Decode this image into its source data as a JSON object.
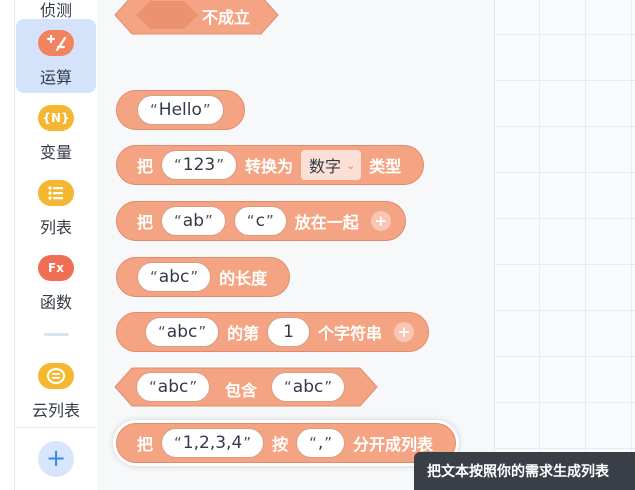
{
  "sidebar": {
    "items": [
      {
        "label": "侦测",
        "icon": "sensing-icon",
        "color": "#4fbf9f"
      },
      {
        "label": "运算",
        "icon": "operators-icon",
        "color": "#f1845f",
        "active": true,
        "glyph": "+−"
      },
      {
        "label": "变量",
        "icon": "variable-icon",
        "color": "#f4b731",
        "glyph": "{N}"
      },
      {
        "label": "列表",
        "icon": "list-icon",
        "color": "#f4b731",
        "glyph": "≡"
      },
      {
        "label": "函数",
        "icon": "function-icon",
        "color": "#ef6f55",
        "glyph": "Fx"
      },
      {
        "label": "云列表",
        "icon": "cloud-list-icon",
        "color": "#f4b731",
        "glyph": "☰"
      }
    ],
    "add_button": "+"
  },
  "blocks": {
    "not_true": {
      "label": "不成立"
    },
    "text_literal": {
      "value": "Hello"
    },
    "convert": {
      "prefix": "把",
      "value": "123",
      "middle": "转换为",
      "type_value": "数字",
      "suffix": "类型"
    },
    "join": {
      "prefix": "把",
      "value1": "ab",
      "value2": "c",
      "suffix": "放在一起",
      "add": "+"
    },
    "length": {
      "value": "abc",
      "suffix": "的长度"
    },
    "char_at": {
      "value": "abc",
      "middle": "的第",
      "index": "1",
      "suffix": "个字符串",
      "add": "+"
    },
    "contains": {
      "value1": "abc",
      "middle": "包含",
      "value2": "abc"
    },
    "split": {
      "prefix": "把",
      "value": "1,2,3,4",
      "middle": "按",
      "delimiter": ",",
      "suffix": "分开成列表"
    }
  },
  "quote_open": "“",
  "quote_close": "”",
  "tooltip": {
    "text": "把文本按照你的需求生成列表"
  },
  "colors": {
    "operator_block": "#f5a483",
    "operator_border": "#e08c6c",
    "active_category_bg": "#d5e3fa",
    "tooltip_bg": "#3a3f47"
  }
}
